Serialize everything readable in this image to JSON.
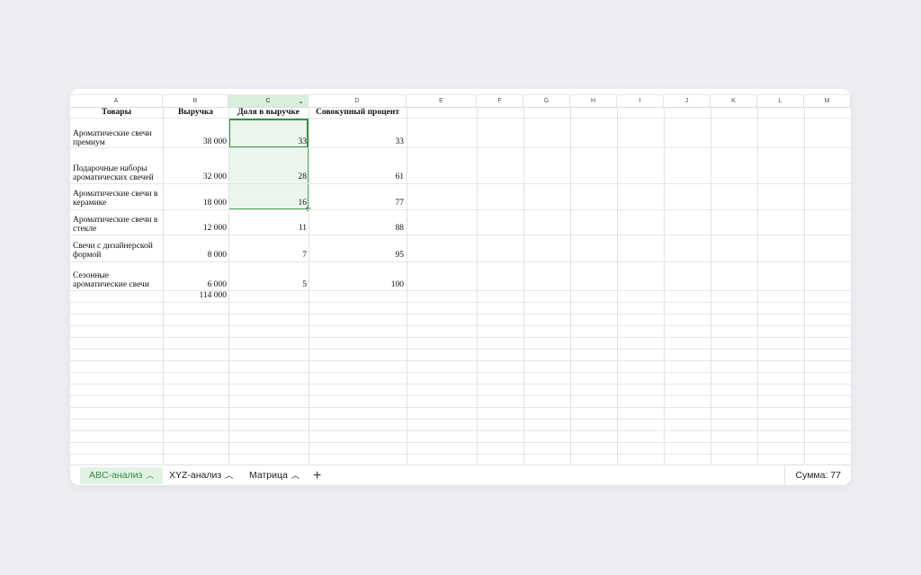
{
  "columns": [
    "A",
    "B",
    "C",
    "D",
    "E",
    "F",
    "G",
    "H",
    "I",
    "J",
    "K",
    "L",
    "M"
  ],
  "headers": {
    "a": "Товары",
    "b": "Выручка",
    "c": "Доля в выручке",
    "d": "Совокупный процент"
  },
  "rows": [
    {
      "name": "Ароматические свечи премиум",
      "revenue": "38 000",
      "share": "33",
      "cumulative": "33"
    },
    {
      "name": "Подарочные наборы ароматических свечей",
      "revenue": "32 000",
      "share": "28",
      "cumulative": "61"
    },
    {
      "name": "Ароматические свечи в керамике",
      "revenue": "18 000",
      "share": "16",
      "cumulative": "77"
    },
    {
      "name": "Ароматические свечи в стекле",
      "revenue": "12 000",
      "share": "11",
      "cumulative": "88"
    },
    {
      "name": "Свечи с дизайнерской формой",
      "revenue": "8 000",
      "share": "7",
      "cumulative": "95"
    },
    {
      "name": "Сезонные ароматические свечи",
      "revenue": "6 000",
      "share": "5",
      "cumulative": "100"
    }
  ],
  "total_revenue": "114 000",
  "tabs": [
    {
      "label": "ABC-анализ",
      "active": true
    },
    {
      "label": "XYZ-анализ",
      "active": false
    },
    {
      "label": "Матрица",
      "active": false
    }
  ],
  "status": {
    "sum_label": "Сумма: 77"
  },
  "colors": {
    "accent": "#3c8f47",
    "selection_fill": "#eaf6ec",
    "active_tab_bg": "#e2f3e4"
  }
}
